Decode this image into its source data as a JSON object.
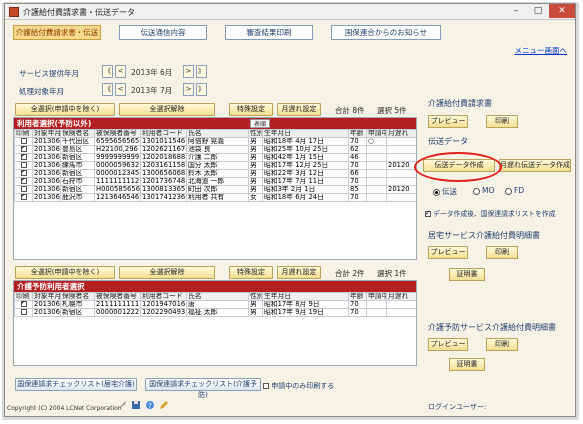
{
  "window": {
    "title": "介護給付費請求書・伝送データ",
    "min": "–",
    "max": "□",
    "close": "✕"
  },
  "tabs": [
    {
      "label": "介護給付費請求書・伝送"
    },
    {
      "label": "伝送通信内容"
    },
    {
      "label": "審査結果印刷"
    },
    {
      "label": "国保連合からのお知らせ"
    }
  ],
  "menu_link": "メニュー画面へ",
  "service_year": {
    "label": "サービス提供年月",
    "value": "2013年 6月",
    "prev2": "《",
    "prev": "<",
    "next": ">",
    "next2": "》"
  },
  "process_year": {
    "label": "処理対象年月",
    "value": "2013年 7月",
    "prev2": "《",
    "prev": "<",
    "next": ">",
    "next2": "》"
  },
  "top_toolbar": {
    "select_all": "全選択(申請中を除く)",
    "deselect_all": "全選択解除",
    "special": "特殊設定",
    "late": "月遅れ設定",
    "total": "合計 8件",
    "selected": "選択 5件"
  },
  "grid1": {
    "title": "利用者選択(予防以外)",
    "tag": "表順",
    "columns": [
      "印刷",
      "対象年月",
      "保険者名",
      "被保険者番号",
      "利用者コード",
      "氏名",
      "性別",
      "生年月日",
      "年齢",
      "申請中",
      "月遅れ"
    ],
    "rows": [
      {
        "checked": false,
        "ym": "201306",
        "insurer": "千代田区",
        "number": "6595656565",
        "code": "1301011546",
        "name": "阿倍野 晃義",
        "sex": "男",
        "birth": "昭和18年 4月 17日",
        "age": "70",
        "pending": "○",
        "late": ""
      },
      {
        "checked": true,
        "ym": "201306",
        "insurer": "豊島区",
        "number": "H22100,296",
        "code": "1202621167",
        "name": "池袋 良",
        "sex": "男",
        "birth": "昭和25年 10月 25日",
        "age": "62",
        "pending": "",
        "late": ""
      },
      {
        "checked": true,
        "ym": "201306",
        "insurer": "新宿区",
        "number": "9999999999",
        "code": "1202018688",
        "name": "介護 二郎",
        "sex": "男",
        "birth": "昭和42年 1月 15日",
        "age": "46",
        "pending": "",
        "late": ""
      },
      {
        "checked": false,
        "ym": "201306",
        "insurer": "練馬市",
        "number": "0000059632",
        "code": "1203161158",
        "name": "国分 太郎",
        "sex": "男",
        "birth": "昭和17年 12月 25日",
        "age": "70",
        "pending": "",
        "late": "20120"
      },
      {
        "checked": true,
        "ym": "201306",
        "insurer": "新宿区",
        "number": "0000012345",
        "code": "1300656068",
        "name": "鈴木 太郎",
        "sex": "男",
        "birth": "昭和22年 3月 12日",
        "age": "66",
        "pending": "",
        "late": ""
      },
      {
        "checked": true,
        "ym": "201306",
        "insurer": "石狩市",
        "number": "1111111112",
        "code": "1201736748",
        "name": "北海道 一郎",
        "sex": "男",
        "birth": "昭和17年 7月 11日",
        "age": "70",
        "pending": "",
        "late": ""
      },
      {
        "checked": false,
        "ym": "201306",
        "insurer": "新宿区",
        "number": "H000585656",
        "code": "1300813365",
        "name": "町田 次郎",
        "sex": "男",
        "birth": "昭和3年 2月 1日",
        "age": "85",
        "pending": "",
        "late": "20120"
      },
      {
        "checked": true,
        "ym": "201306",
        "insurer": "鹿沢市",
        "number": "1213646546",
        "code": "1301741236",
        "name": "利用者 共有",
        "sex": "女",
        "birth": "昭和18年 6月 24日",
        "age": "70",
        "pending": "",
        "late": ""
      }
    ]
  },
  "mid_toolbar": {
    "select_all": "全選択(申請中を除く)",
    "deselect_all": "全選択解除",
    "special": "特殊設定",
    "late": "月遅れ設定",
    "total": "合計 2件",
    "selected": "選択 1件"
  },
  "grid2": {
    "title": "介護予防利用者選択",
    "tag": "表順",
    "columns": [
      "印刷",
      "対象年月",
      "保険者名",
      "被保険者番号",
      "利用者コード",
      "氏名",
      "性別",
      "生年月日",
      "年齢",
      "申請中",
      "月遅れ"
    ],
    "rows": [
      {
        "checked": true,
        "ym": "201306",
        "insurer": "札幌市",
        "number": "2111111111",
        "code": "1201947016",
        "name": "唐",
        "sex": "男",
        "birth": "昭和17年 8月 9日",
        "age": "70",
        "pending": "",
        "late": ""
      },
      {
        "checked": false,
        "ym": "201306",
        "insurer": "新宿区",
        "number": "0000001222",
        "code": "1202290493",
        "name": "福祉 太郎",
        "sex": "男",
        "birth": "昭和17年 9月 19日",
        "age": "70",
        "pending": "",
        "late": ""
      }
    ]
  },
  "bottom": {
    "check1": "国保連請求チェックリスト(居宅介護)",
    "check2": "国保連請求チェックリスト(介護予防)",
    "pending_print": "申請中のみ印刷する"
  },
  "right_panel": {
    "claim_title": "介護給付費請求書",
    "claim_preview": "プレビュー",
    "claim_print": "印刷",
    "transfer_title": "伝送データ",
    "create_data": "伝送データ作成",
    "create_late": "月遅れ伝送データ作成",
    "radio_transfer": "伝送",
    "radio_mo": "MO",
    "radio_fd": "FD",
    "auto_print": "データ作成後、国保連請求リストを作成",
    "home_title": "居宅サービス介護給付費明細書",
    "home_preview": "プレビュー",
    "home_print": "印刷",
    "home_cert": "証明書",
    "prevent_title": "介護予防サービス介護給付費明細書",
    "prevent_preview": "プレビュー",
    "prevent_print": "印刷",
    "prevent_cert": "証明書",
    "login": "ログインユーザー:"
  },
  "footer": {
    "copyright": "Copyright (C) 2004 LCNet Corporation"
  },
  "colors": {
    "accent_red": "#b41f22",
    "highlight": "#e0201c",
    "button_gold": "#f3df93"
  }
}
